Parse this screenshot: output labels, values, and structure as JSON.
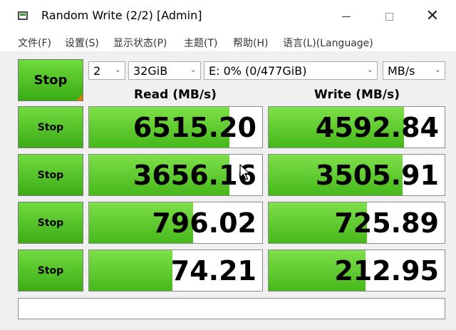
{
  "window": {
    "title": "Random Write (2/2) [Admin]",
    "icons": {
      "app": "app-icon",
      "minimize": "minimize-icon",
      "maximize": "maximize-icon",
      "close": "close-icon"
    }
  },
  "menu": [
    "文件(F)",
    "设置(S)",
    "显示状态(P)",
    "主题(T)",
    "帮助(H)",
    "语言(L)(Language)"
  ],
  "controls": {
    "stop_all_label": "Stop",
    "count": "2",
    "size": "32GiB",
    "drive": "E: 0% (0/477GiB)",
    "unit": "MB/s"
  },
  "headers": {
    "read": "Read (MB/s)",
    "write": "Write (MB/s)"
  },
  "rows": [
    {
      "stop_label": "Stop",
      "read": "6515.20",
      "write": "4592.84",
      "read_level": 0.81,
      "write_level": 0.77
    },
    {
      "stop_label": "Stop",
      "read": "3656.16",
      "write": "3505.91",
      "read_level": 0.81,
      "write_level": 0.76
    },
    {
      "stop_label": "Stop",
      "read": "796.02",
      "write": "725.89",
      "read_level": 0.6,
      "write_level": 0.56
    },
    {
      "stop_label": "Stop",
      "read": "74.21",
      "write": "212.95",
      "read_level": 0.48,
      "write_level": 0.55
    }
  ],
  "colors": {
    "accent_green": "#46b81a",
    "corner_orange": "#e07b00"
  }
}
